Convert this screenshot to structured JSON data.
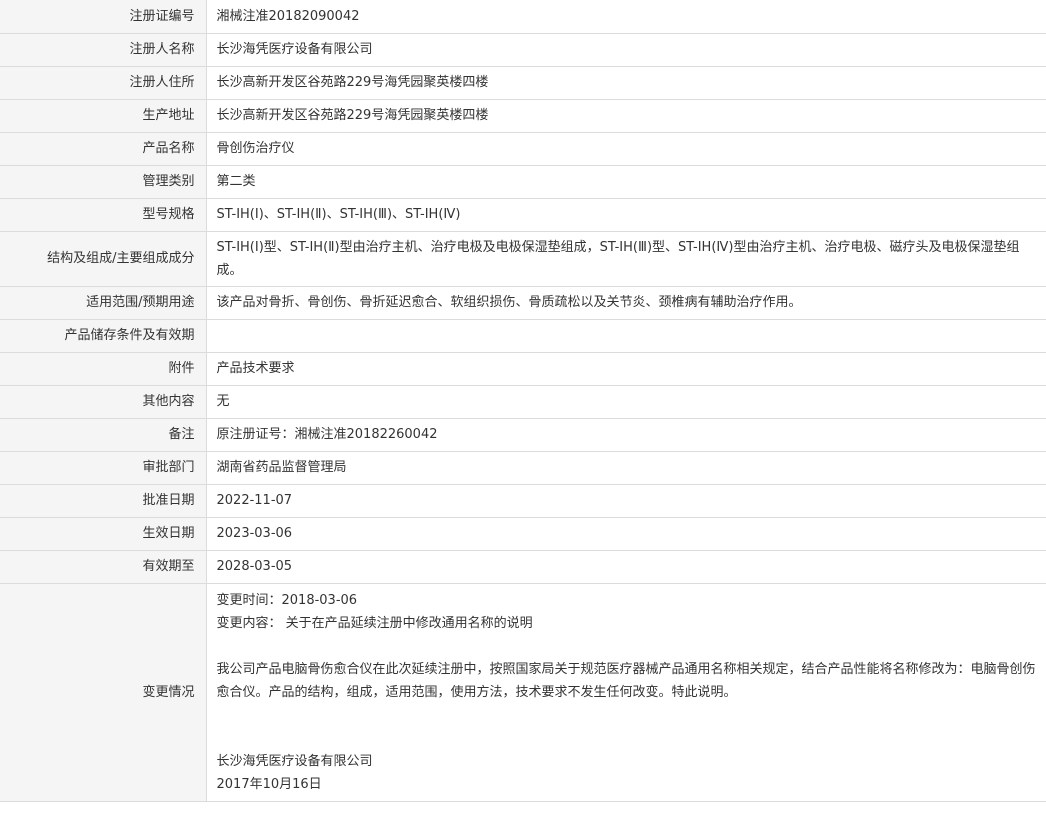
{
  "rows": [
    {
      "label": "注册证编号",
      "value": "湘械注准20182090042"
    },
    {
      "label": "注册人名称",
      "value": "长沙海凭医疗设备有限公司"
    },
    {
      "label": "注册人住所",
      "value": "长沙高新开发区谷苑路229号海凭园聚英楼四楼"
    },
    {
      "label": "生产地址",
      "value": "长沙高新开发区谷苑路229号海凭园聚英楼四楼"
    },
    {
      "label": "产品名称",
      "value": "骨创伤治疗仪"
    },
    {
      "label": "管理类别",
      "value": "第二类"
    },
    {
      "label": "型号规格",
      "value": "ST-IH(Ⅰ)、ST-IH(Ⅱ)、ST-IH(Ⅲ)、ST-IH(Ⅳ)"
    },
    {
      "label": "结构及组成/主要组成成分",
      "value": "ST-IH(Ⅰ)型、ST-IH(Ⅱ)型由治疗主机、治疗电极及电极保湿垫组成，ST-IH(Ⅲ)型、ST-IH(Ⅳ)型由治疗主机、治疗电极、磁疗头及电极保湿垫组成。"
    },
    {
      "label": "适用范围/预期用途",
      "value": "该产品对骨折、骨创伤、骨折延迟愈合、软组织损伤、骨质疏松以及关节炎、颈椎病有辅助治疗作用。"
    },
    {
      "label": "产品储存条件及有效期",
      "value": ""
    },
    {
      "label": "附件",
      "value": "产品技术要求"
    },
    {
      "label": "其他内容",
      "value": "无"
    },
    {
      "label": "备注",
      "value": "原注册证号：湘械注准20182260042"
    },
    {
      "label": "审批部门",
      "value": "湖南省药品监督管理局"
    },
    {
      "label": "批准日期",
      "value": "2022-11-07"
    },
    {
      "label": "生效日期",
      "value": "2023-03-06"
    },
    {
      "label": "有效期至",
      "value": "2028-03-05"
    }
  ],
  "change": {
    "label": "变更情况",
    "time": "变更时间：2018-03-06",
    "content": "变更内容： 关于在产品延续注册中修改通用名称的说明",
    "body": "我公司产品电脑骨伤愈合仪在此次延续注册中，按照国家局关于规范医疗器械产品通用名称相关规定，结合产品性能将名称修改为：电脑骨创伤愈合仪。产品的结构，组成，适用范围，使用方法，技术要求不发生任何改变。特此说明。",
    "company": "长沙海凭医疗设备有限公司",
    "date": "2017年10月16日"
  }
}
